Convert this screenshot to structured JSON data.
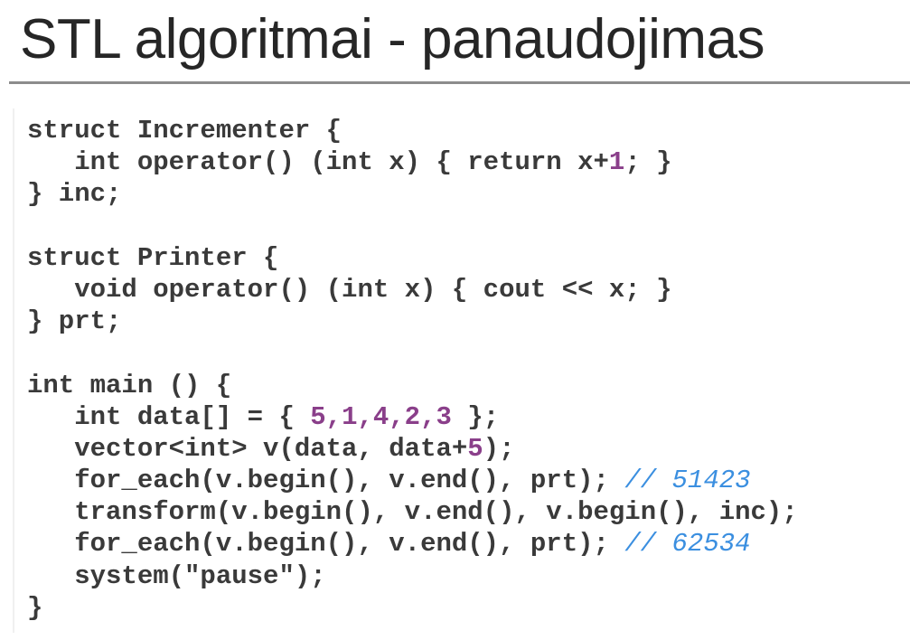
{
  "slide": {
    "title": "STL algoritmai - panaudojimas"
  },
  "code": {
    "l1": "struct Incrementer {",
    "l2a": "   int operator() (int x) { return x+",
    "l2n": "1",
    "l2b": "; }",
    "l3": "} inc;",
    "l5": "struct Printer {",
    "l6": "   void operator() (int x) { cout << x; }",
    "l7": "} prt;",
    "l9": "int main () {",
    "l10a": "   int data[] = { ",
    "l10n": "5,1,4,2,3",
    "l10b": " };",
    "l11a": "   vector<int> v(data, data+",
    "l11n": "5",
    "l11b": ");",
    "l12a": "   for_each(v.begin(), v.end(), prt); ",
    "l12c": "// 51423",
    "l13": "   transform(v.begin(), v.end(), v.begin(), inc);",
    "l14a": "   for_each(v.begin(), v.end(), prt); ",
    "l14c": "// 62534",
    "l15": "   system(\"pause\");",
    "l16": "}"
  },
  "colors": {
    "text": "#3a3a3a",
    "number": "#8a3f8a",
    "comment": "#3b8fe0",
    "title": "#262626",
    "rule": "#8c8c8c"
  }
}
